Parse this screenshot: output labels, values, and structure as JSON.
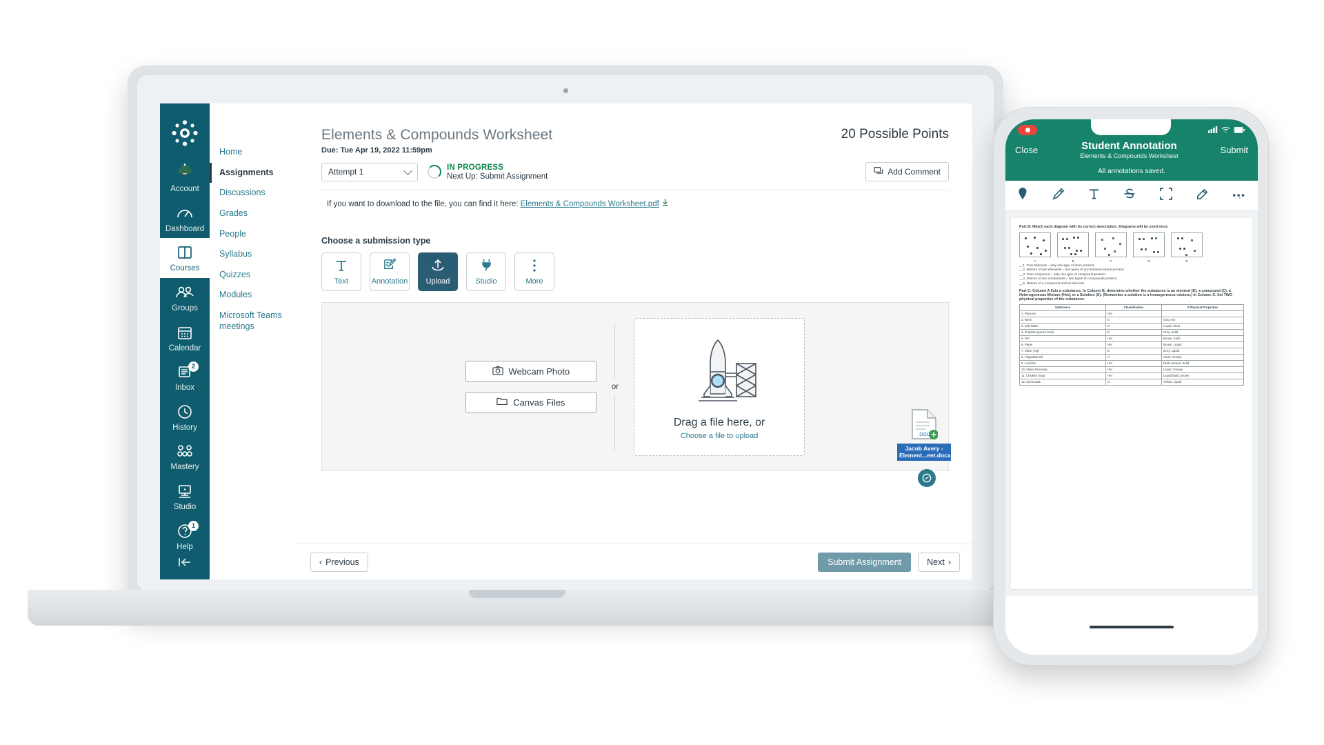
{
  "global_nav": {
    "logo_icon": "canvas-logo-icon",
    "items": [
      {
        "label": "Account",
        "icon": "avatar-icon",
        "badge": null,
        "active": false
      },
      {
        "label": "Dashboard",
        "icon": "dashboard-icon",
        "badge": null,
        "active": false
      },
      {
        "label": "Courses",
        "icon": "courses-icon",
        "badge": null,
        "active": true
      },
      {
        "label": "Groups",
        "icon": "groups-icon",
        "badge": null,
        "active": false
      },
      {
        "label": "Calendar",
        "icon": "calendar-icon",
        "badge": null,
        "active": false
      },
      {
        "label": "Inbox",
        "icon": "inbox-icon",
        "badge": "2",
        "active": false
      },
      {
        "label": "History",
        "icon": "clock-icon",
        "badge": null,
        "active": false
      },
      {
        "label": "Mastery",
        "icon": "mastery-icon",
        "badge": null,
        "active": false
      },
      {
        "label": "Studio",
        "icon": "studio-icon",
        "badge": null,
        "active": false
      },
      {
        "label": "Help",
        "icon": "help-icon",
        "badge": "1",
        "active": false
      }
    ],
    "collapse_icon": "collapse-arrow-icon"
  },
  "course_nav": {
    "items": [
      {
        "label": "Home",
        "active": false
      },
      {
        "label": "Assignments",
        "active": true
      },
      {
        "label": "Discussions",
        "active": false
      },
      {
        "label": "Grades",
        "active": false
      },
      {
        "label": "People",
        "active": false
      },
      {
        "label": "Syllabus",
        "active": false
      },
      {
        "label": "Quizzes",
        "active": false
      },
      {
        "label": "Modules",
        "active": false
      },
      {
        "label": "Microsoft Teams meetings",
        "active": false
      }
    ]
  },
  "assignment": {
    "title": "Elements & Compounds Worksheet",
    "due": "Due: Tue Apr 19, 2022 11:59pm",
    "possible_points": "20 Possible Points",
    "attempt_value": "Attempt 1",
    "status_label": "IN PROGRESS",
    "status_next": "Next Up: Submit Assignment",
    "add_comment_label": "Add Comment",
    "download_text": "If you want to download to the file, you can find it here:",
    "download_link": "Elements & Compounds Worksheet.pdf"
  },
  "submission": {
    "section_title": "Choose a submission type",
    "types": [
      {
        "label": "Text",
        "icon": "text-icon",
        "active": false
      },
      {
        "label": "Annotation",
        "icon": "annotation-icon",
        "active": false
      },
      {
        "label": "Upload",
        "icon": "upload-icon",
        "active": true
      },
      {
        "label": "Studio",
        "icon": "plug-icon",
        "active": false
      },
      {
        "label": "More",
        "icon": "more-vertical-icon",
        "active": false
      }
    ],
    "webcam_label": "Webcam Photo",
    "canvas_files_label": "Canvas Files",
    "or_label": "or",
    "drop_title": "Drag a file here, or",
    "drop_sub": "Choose a file to upload",
    "dragged_file": "Jacob Avery - Element...eet.docx"
  },
  "footer": {
    "previous_label": "Previous",
    "next_label": "Next",
    "submit_label": "Submit Assignment"
  },
  "phone": {
    "close_label": "Close",
    "submit_label": "Submit",
    "title": "Student Annotation",
    "subtitle": "Elements & Compounds Worksheet",
    "saved_text": "All annotations saved.",
    "tools": [
      {
        "icon": "pin-icon"
      },
      {
        "icon": "pencil-icon"
      },
      {
        "icon": "text-tool-icon"
      },
      {
        "icon": "strikethrough-icon"
      },
      {
        "icon": "square-select-icon"
      },
      {
        "icon": "highlighter-icon"
      },
      {
        "icon": "more-options-icon"
      }
    ],
    "document": {
      "part_b_heading": "Part B: Match each diagram with its correct description.  Diagrams will be used once.",
      "diagram_labels": [
        "A",
        "B",
        "C",
        "D",
        "E"
      ],
      "questions": [
        "__1. Pure Element – only one type of atom present.",
        "__2. Mixture of two elements – two types of uncombined atoms present.",
        "__3. Pure compound – only one type of compound present.",
        "__4. Mixture of two compounds – two types of compounds present.",
        "__5. Mixture of a compound and an element."
      ],
      "part_c_heading": "Part C: Column A lists a substance.  In Column B, determine whether the substance is an element (E), a compound (C), a Heterogeneous Mixture (Het), or a Solution (S).  (Remember a solution is a homogeneous mixture.)  In Column C, list TWO physical properties of the substance.",
      "table_headers": [
        "Substance",
        "Classification",
        "2 Physical Properties"
      ],
      "table_rows": [
        [
          "1. Popcorn",
          "Het",
          ""
        ],
        [
          "2. Neon",
          "E",
          "Gas, Hot"
        ],
        [
          "3. Salt Water",
          "S",
          "Liquid, Clear"
        ],
        [
          "4. Graphite (pencil lead)",
          "E",
          "Grey, Solid"
        ],
        [
          "5. Dirt",
          "Het",
          "Brown, Solid"
        ],
        [
          "6. Paper",
          "Het",
          "Brown, Liquid"
        ],
        [
          "7. Silver (Ag)",
          "E",
          "Grey, Liquid"
        ],
        [
          "8. Vegetable Oil",
          "C",
          "Clear, Greasy"
        ],
        [
          "9. A burrito",
          "Het",
          "Multi-colored, Solid"
        ],
        [
          "10. Italian Dressing",
          "Het",
          "Liquid, Greasy"
        ],
        [
          "11. Chicken Soup",
          "Het",
          "Liquid/Solid, Brown"
        ],
        [
          "12. Lemonade",
          "S",
          "Yellow, Liquid"
        ]
      ]
    }
  },
  "colors": {
    "canvas_teal": "#0f5c6e",
    "link_teal": "#2b7a8c",
    "active_tile": "#2a5d74",
    "green": "#0b874b",
    "phone_green": "#17836a",
    "chip_blue": "#2b6cb8"
  }
}
